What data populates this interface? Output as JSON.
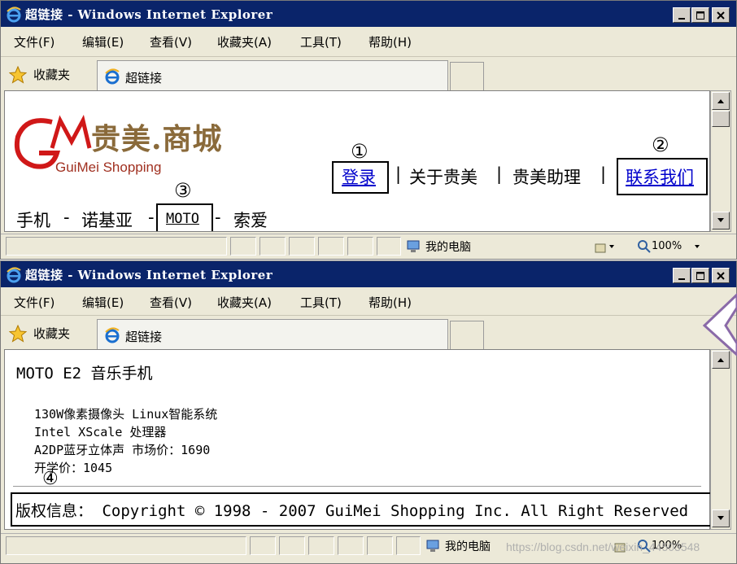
{
  "window_title": "超链接 - Windows Internet Explorer",
  "menu": [
    "文件(F)",
    "编辑(E)",
    "查看(V)",
    "收藏夹(A)",
    "工具(T)",
    "帮助(H)"
  ],
  "favorites_label": "收藏夹",
  "tab_label": "超链接",
  "status": {
    "zone": "我的电脑",
    "zoom": "100%"
  },
  "page1": {
    "logo_text": "贵美.商城",
    "logo_sub": "GuiMei Shopping",
    "nav": {
      "login": "登录",
      "about": "关于贵美",
      "helper": "贵美助理",
      "contact": "联系我们",
      "sep": "|"
    },
    "categories": {
      "phone": "手机",
      "nokia": "诺基亚",
      "moto": "MOTO",
      "sony": "索爱",
      "dash": "-"
    },
    "markers": {
      "m1": "①",
      "m2": "②",
      "m3": "③"
    }
  },
  "page2": {
    "title": "MOTO E2 音乐手机",
    "specs": [
      "130W像素摄像头 Linux智能系统",
      "Intel XScale 处理器",
      "A2DP蓝牙立体声 市场价：1690",
      "开学价：1045"
    ],
    "marker": "④",
    "copyright": "版权信息： Copyright © 1998 - 2007 GuiMei Shopping Inc. All Right Reserved"
  },
  "watermark": "https://blog.csdn.net/weixin_44503548",
  "colors": {
    "titlebar": "#0a246a",
    "link": "#0000cc"
  }
}
